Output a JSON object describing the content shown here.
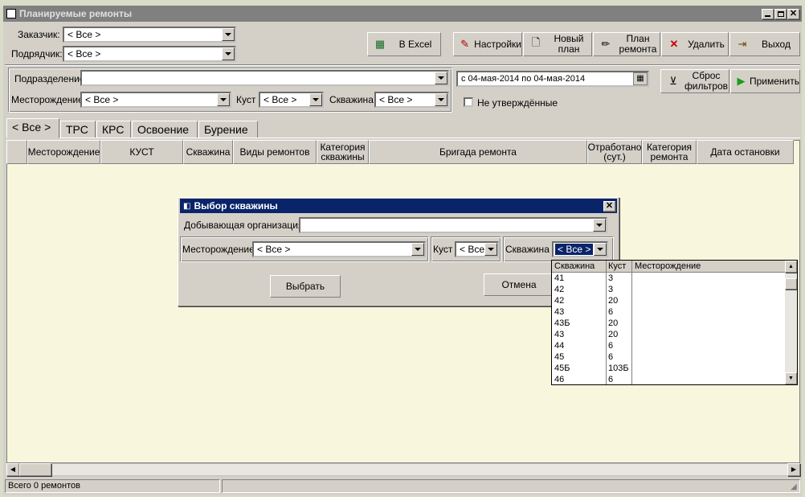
{
  "window": {
    "title": "Планируемые ремонты"
  },
  "filters": {
    "customer_label": "Заказчик:",
    "customer_value": "< Все >",
    "contractor_label": "Подрядчик:",
    "contractor_value": "< Все >"
  },
  "toolbar": {
    "excel": "В Excel",
    "settings": "Настройки",
    "new_plan": "Новый план",
    "repair_plan": "План ремонта",
    "delete": "Удалить",
    "exit": "Выход"
  },
  "filters2": {
    "division_label": "Подразделение",
    "division_value": "",
    "field_label": "Месторождение",
    "field_value": "< Все >",
    "bush_label": "Куст",
    "bush_value": "< Все >",
    "well_label": "Скважина",
    "well_value": "< Все >",
    "date_range": "с 04-мая-2014 по 04-мая-2014",
    "not_approved": "Не утверждённые",
    "reset": "Сброс фильтров",
    "apply": "Применить"
  },
  "tabs": [
    "< Все >",
    "ТРС",
    "КРС",
    "Освоение",
    "Бурение"
  ],
  "table": {
    "columns": [
      "Месторождение",
      "КУСТ",
      "Скважина",
      "Виды ремонтов",
      "Категория скважины",
      "Бригада ремонта",
      "Отработано (сут.)",
      "Категория ремонта",
      "Дата остановки"
    ]
  },
  "status": {
    "text": "Всего  0 ремонтов"
  },
  "dialog": {
    "title": "Выбор скважины",
    "org_label": "Добывающая организация",
    "org_value": "",
    "field_label": "Месторождение",
    "field_value": "< Все >",
    "bush_label": "Куст",
    "bush_value": "< Все",
    "well_label": "Скважина",
    "well_value": "< Все >",
    "select": "Выбрать",
    "cancel": "Отмена",
    "list_headers": [
      "Скважина",
      "Куст",
      "Месторождение"
    ],
    "list_rows": [
      [
        "41",
        "3",
        ""
      ],
      [
        "42",
        "3",
        ""
      ],
      [
        "42",
        "20",
        ""
      ],
      [
        "43",
        "6",
        ""
      ],
      [
        "43Б",
        "20",
        ""
      ],
      [
        "43",
        "20",
        ""
      ],
      [
        "44",
        "6",
        ""
      ],
      [
        "45",
        "6",
        ""
      ],
      [
        "45Б",
        "103Б",
        ""
      ],
      [
        "46",
        "6",
        ""
      ]
    ]
  },
  "colors": {
    "titlebar": "#808080",
    "dialog_titlebar": "#0a246a",
    "grid_bg": "#f8f6dc",
    "selection": "#0a246a"
  }
}
